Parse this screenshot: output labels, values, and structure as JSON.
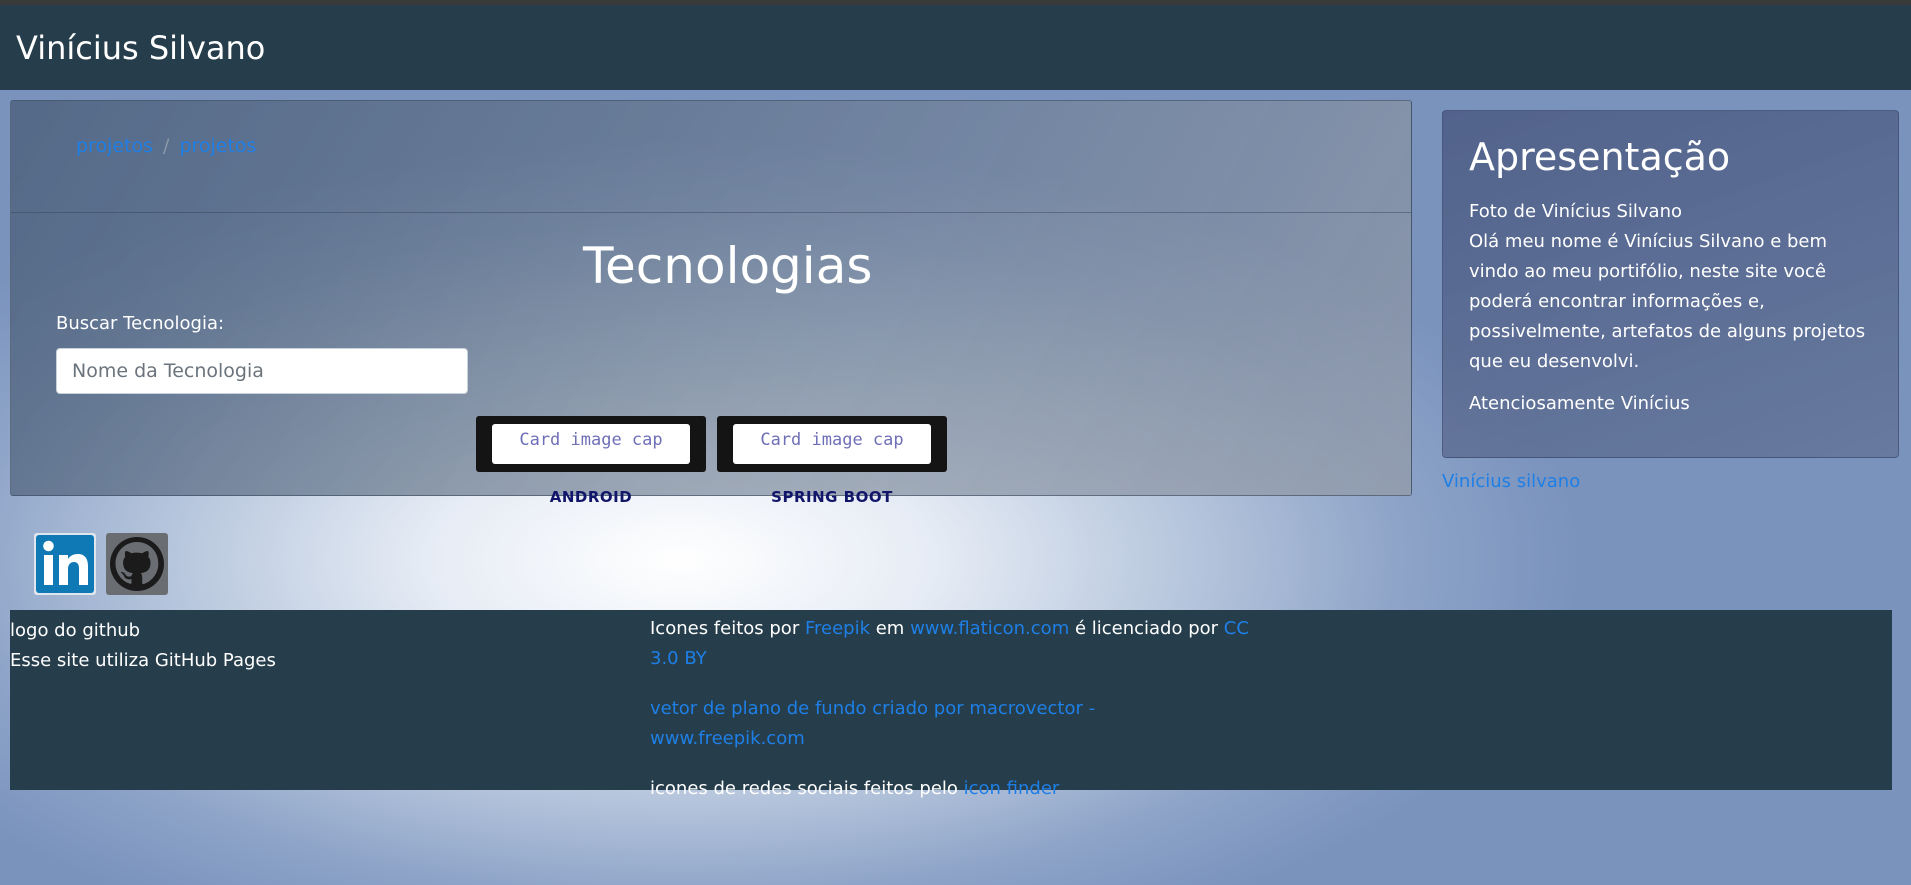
{
  "navbar": {
    "brand": "Vinícius Silvano"
  },
  "breadcrumb": {
    "items": [
      "projetos",
      "projetos"
    ],
    "separator": "/"
  },
  "main": {
    "title": "Tecnologias",
    "search_label": "Buscar Tecnologia:",
    "search_placeholder": "Nome da Tecnologia",
    "cards": [
      {
        "image_alt": "Card image cap",
        "name": "ANDROID"
      },
      {
        "image_alt": "Card image cap",
        "name": "SPRING BOOT"
      }
    ]
  },
  "sidebar": {
    "title": "Apresentação",
    "photo_alt": "Foto de Vinícius Silvano",
    "text": "Olá meu nome é Vinícius Silvano e bem vindo ao meu portifólio, neste site você poderá encontrar informações e, possivelmente, artefatos de alguns projetos que eu desenvolvi.",
    "signature": "Atenciosamente Vinícius",
    "link": "Vinícius silvano"
  },
  "social": {
    "linkedin_icon": "linkedin-icon",
    "github_icon": "github-icon"
  },
  "footer": {
    "left_line1": "logo do github",
    "left_line2": "Esse site utiliza GitHub Pages",
    "credits1": {
      "prefix": "Icones feitos por ",
      "author": "Freepik",
      "mid": " em ",
      "site": "www.flaticon.com",
      "license_text": " é licenciado por ",
      "license": "CC 3.0 BY"
    },
    "credits2": "vetor de plano de fundo criado por macrovector - www.freepik.com",
    "credits3": {
      "prefix": "icones de redes sociais feitos pelo ",
      "link": "icon finder"
    }
  },
  "colors": {
    "navbar": "#263e4b",
    "link": "#1e7fe6",
    "tech_name": "#12166b"
  }
}
